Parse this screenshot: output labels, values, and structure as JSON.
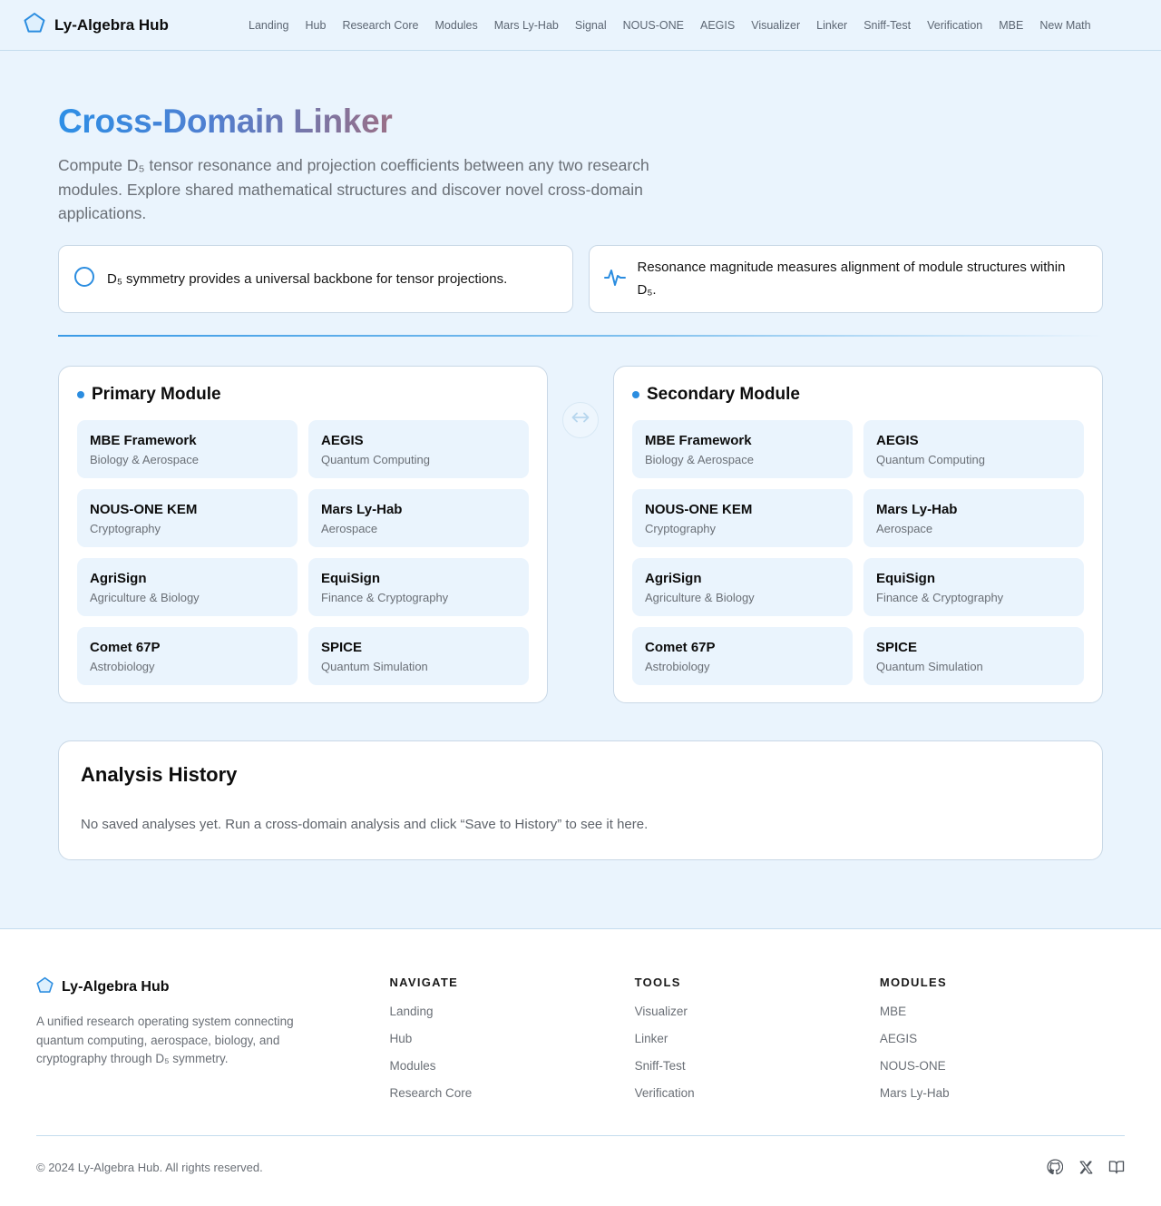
{
  "brand": {
    "name": "Ly-Algebra Hub"
  },
  "nav": {
    "items": [
      "Landing",
      "Hub",
      "Research Core",
      "Modules",
      "Mars Ly-Hab",
      "Signal",
      "NOUS-ONE",
      "AEGIS",
      "Visualizer",
      "Linker",
      "Sniff-Test",
      "Verification",
      "MBE",
      "New Math"
    ]
  },
  "hero": {
    "title": "Cross-Domain Linker",
    "subtitle": "Compute D₅ tensor resonance and projection coefficients between any two research modules. Explore shared mathematical structures and discover novel cross-domain applications."
  },
  "notes": [
    {
      "icon": "circle-icon",
      "text": "D₅ symmetry provides a universal backbone for tensor projections."
    },
    {
      "icon": "pulse-icon",
      "text": "Resonance magnitude measures alignment of module structures within D₅."
    }
  ],
  "primary": {
    "title": "Primary Module",
    "items": [
      {
        "name": "MBE Framework",
        "domain": "Biology & Aerospace"
      },
      {
        "name": "AEGIS",
        "domain": "Quantum Computing"
      },
      {
        "name": "NOUS-ONE KEM",
        "domain": "Cryptography"
      },
      {
        "name": "Mars Ly-Hab",
        "domain": "Aerospace"
      },
      {
        "name": "AgriSign",
        "domain": "Agriculture & Biology"
      },
      {
        "name": "EquiSign",
        "domain": "Finance & Cryptography"
      },
      {
        "name": "Comet 67P",
        "domain": "Astrobiology"
      },
      {
        "name": "SPICE",
        "domain": "Quantum Simulation"
      }
    ]
  },
  "secondary": {
    "title": "Secondary Module",
    "items": [
      {
        "name": "MBE Framework",
        "domain": "Biology & Aerospace"
      },
      {
        "name": "AEGIS",
        "domain": "Quantum Computing"
      },
      {
        "name": "NOUS-ONE KEM",
        "domain": "Cryptography"
      },
      {
        "name": "Mars Ly-Hab",
        "domain": "Aerospace"
      },
      {
        "name": "AgriSign",
        "domain": "Agriculture & Biology"
      },
      {
        "name": "EquiSign",
        "domain": "Finance & Cryptography"
      },
      {
        "name": "Comet 67P",
        "domain": "Astrobiology"
      },
      {
        "name": "SPICE",
        "domain": "Quantum Simulation"
      }
    ]
  },
  "swap": {
    "icon": "swap-arrows-icon"
  },
  "history": {
    "title": "Analysis History",
    "empty_text": "No saved analyses yet. Run a cross-domain analysis and click “Save to History” to see it here."
  },
  "footer": {
    "brand_name": "Ly-Algebra Hub",
    "description": "A unified research operating system connecting quantum computing, aerospace, biology, and cryptography through D₅ symmetry.",
    "columns": [
      {
        "title": "NAVIGATE",
        "links": [
          "Landing",
          "Hub",
          "Modules",
          "Research Core"
        ]
      },
      {
        "title": "TOOLS",
        "links": [
          "Visualizer",
          "Linker",
          "Sniff-Test",
          "Verification"
        ]
      },
      {
        "title": "MODULES",
        "links": [
          "MBE",
          "AEGIS",
          "NOUS-ONE",
          "Mars Ly-Hab"
        ]
      }
    ],
    "copyright": "© 2024 Ly-Algebra Hub. All rights reserved.",
    "socials": [
      "github-icon",
      "x-icon",
      "book-icon"
    ]
  },
  "colors": {
    "accent": "#2b8de0",
    "page_bg": "#eaf4fd",
    "card_bg": "#ffffff",
    "border": "#c9d8e6"
  }
}
